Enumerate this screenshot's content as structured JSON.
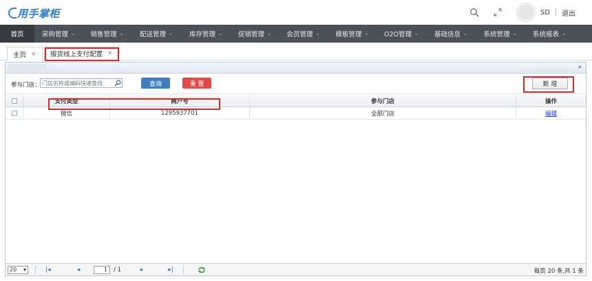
{
  "header": {
    "logo_text": "用手掌柜",
    "username": "SD",
    "logout_label": "退出",
    "icons": [
      "search-icon",
      "fullscreen-icon",
      "avatar"
    ]
  },
  "nav": {
    "items": [
      {
        "label": "首页",
        "dropdown": false,
        "active": true
      },
      {
        "label": "采购管理",
        "dropdown": true
      },
      {
        "label": "销售管理",
        "dropdown": true
      },
      {
        "label": "配送管理",
        "dropdown": true
      },
      {
        "label": "库存管理",
        "dropdown": true
      },
      {
        "label": "促销管理",
        "dropdown": true
      },
      {
        "label": "会员管理",
        "dropdown": true
      },
      {
        "label": "模板管理",
        "dropdown": true
      },
      {
        "label": "O2O管理",
        "dropdown": true
      },
      {
        "label": "基础信息",
        "dropdown": true
      },
      {
        "label": "系统管理",
        "dropdown": true
      },
      {
        "label": "系统报表",
        "dropdown": true
      }
    ],
    "caret": "⌄"
  },
  "tabs": {
    "home": "主页",
    "current": "报货线上支付配置",
    "close_glyph": "×"
  },
  "panel": {
    "collapse_glyph": "»"
  },
  "search": {
    "label": "参与门店：",
    "placeholder": "门店名称或编码快速查找",
    "query_button": "查询",
    "reset_button": "重 置",
    "add_button": "新 增"
  },
  "table": {
    "columns": [
      "支付类型",
      "商户号",
      "参与门店",
      "操作"
    ],
    "rows": [
      {
        "pay_type": "微信",
        "merchant_no": "1295937701",
        "stores": "全部门店",
        "action": "编辑"
      }
    ]
  },
  "pager": {
    "page_size": "20",
    "current_page": "1",
    "total_pages": "/ 1",
    "info": "每页 20 条,共 1 条"
  },
  "colors": {
    "nav_bg": "#4b5158",
    "accent": "#3e7fc1",
    "danger": "#e24a4a",
    "annotation": "#e02424",
    "link": "#1a3fd6"
  }
}
